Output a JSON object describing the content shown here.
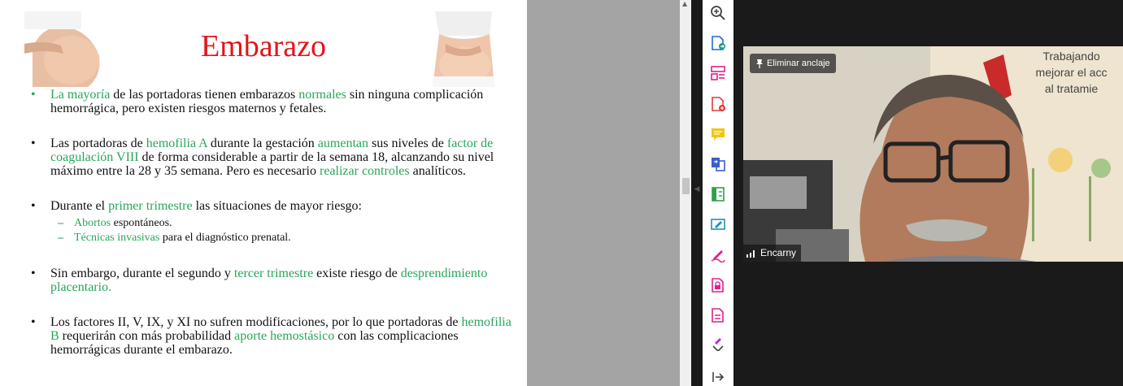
{
  "slide": {
    "title": "Embarazo",
    "bullets": [
      {
        "segments": [
          {
            "t": "La mayoría",
            "h": true
          },
          {
            "t": " de las portadoras tienen embarazos ",
            "h": false
          },
          {
            "t": "normales",
            "h": true
          },
          {
            "t": " sin ninguna complicación hemorrágica, pero existen riesgos maternos y fetales.",
            "h": false
          }
        ]
      },
      {
        "segments": [
          {
            "t": "Las portadoras de ",
            "h": false
          },
          {
            "t": "hemofilia A",
            "h": true
          },
          {
            "t": " durante la gestación ",
            "h": false
          },
          {
            "t": "aumentan",
            "h": true
          },
          {
            "t": " sus niveles de ",
            "h": false
          },
          {
            "t": "factor de coagulación VIII",
            "h": true
          },
          {
            "t": " de forma considerable a partir de la semana 18, alcanzando su nivel máximo entre la 28 y 35 semana. Pero es necesario ",
            "h": false
          },
          {
            "t": "realizar controles",
            "h": true
          },
          {
            "t": " analíticos.",
            "h": false
          }
        ]
      },
      {
        "segments": [
          {
            "t": "Durante el ",
            "h": false
          },
          {
            "t": "primer trimestre",
            "h": true
          },
          {
            "t": " las situaciones de mayor riesgo:",
            "h": false
          }
        ],
        "subs": [
          [
            {
              "t": "Abortos",
              "h": true
            },
            {
              "t": " espontáneos.",
              "h": false
            }
          ],
          [
            {
              "t": "Técnicas invasivas",
              "h": true
            },
            {
              "t": " para el diagnóstico prenatal.",
              "h": false
            }
          ]
        ]
      },
      {
        "segments": [
          {
            "t": "Sin embargo, durante el segundo y ",
            "h": false
          },
          {
            "t": "tercer trimestre",
            "h": true
          },
          {
            "t": " existe riesgo de ",
            "h": false
          },
          {
            "t": "desprendimiento placentario.",
            "h": true
          }
        ]
      },
      {
        "segments": [
          {
            "t": "Los factores II, V, IX, y XI no sufren modificaciones, por lo que portadoras de ",
            "h": false
          },
          {
            "t": "hemofilia B",
            "h": true
          },
          {
            "t": " requerirán con más probabilidad ",
            "h": false
          },
          {
            "t": "aporte hemostásico",
            "h": true
          },
          {
            "t": " con las complicaciones hemorrágicas durante el embarazo.",
            "h": false
          }
        ]
      }
    ]
  },
  "toolbar": {
    "tools": [
      "zoom-in-icon",
      "export-pdf-icon",
      "organize-pages-icon",
      "create-pdf-icon",
      "comment-icon",
      "combine-files-icon",
      "compress-pdf-icon",
      "edit-pdf-icon",
      "fill-sign-icon",
      "protect-pdf-icon",
      "form-icon",
      "more-tools-icon",
      "expand-panel-icon"
    ]
  },
  "video": {
    "pin_label": "Eliminar anclaje",
    "participant_name": "Encarny",
    "poster_text": [
      "Trabajando",
      "mejorar el acc",
      "al tratamie"
    ]
  },
  "colors": {
    "title": "#e3141b",
    "highlight": "#2aa55a",
    "accent": "#e0208a"
  }
}
